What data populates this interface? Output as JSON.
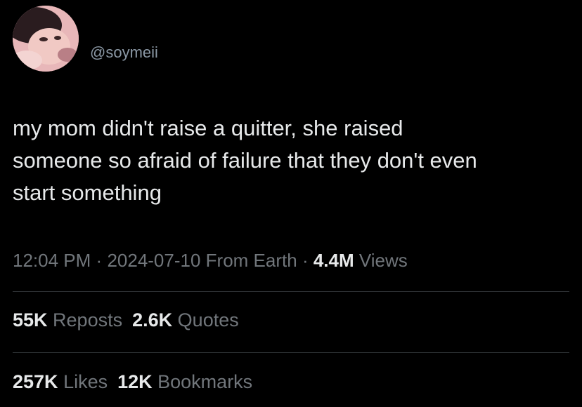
{
  "author": {
    "handle": "@soymeii",
    "avatar_icon": "profile-photo"
  },
  "tweet": {
    "text": "my mom didn't raise a quitter, she raised\nsomeone so afraid of failure that they don't even\nstart something"
  },
  "meta": {
    "time": "12:04 PM",
    "separator": "·",
    "date": "2024-07-10",
    "source": "From Earth",
    "views_count": "4.4M",
    "views_label": "Views"
  },
  "stats": {
    "reposts": {
      "count": "55K",
      "label": "Reposts"
    },
    "quotes": {
      "count": "2.6K",
      "label": "Quotes"
    },
    "likes": {
      "count": "257K",
      "label": "Likes"
    },
    "bookmarks": {
      "count": "12K",
      "label": "Bookmarks"
    }
  },
  "colors": {
    "background": "#000000",
    "text_primary": "#e7e9ea",
    "text_secondary": "#71767b",
    "divider": "#2f3336"
  }
}
